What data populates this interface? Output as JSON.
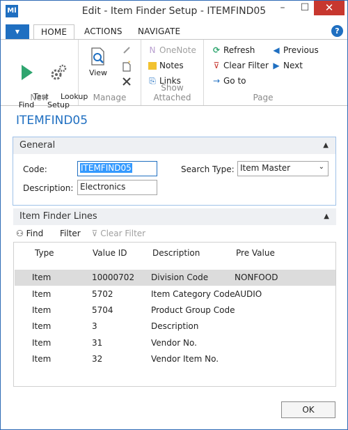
{
  "window": {
    "title": "Edit - Item Finder Setup - ITEMFIND05",
    "app_icon": "Ml",
    "minimize_glyph": "–",
    "maximize_glyph": "☐",
    "close_glyph": "✕"
  },
  "tabs": {
    "home": "HOME",
    "actions": "ACTIONS",
    "navigate": "NAVIGATE"
  },
  "ribbon": {
    "new": {
      "label": "New",
      "test_find": "Test\nFind",
      "lookup_setup": "Lookup\nSetup"
    },
    "manage": {
      "label": "Manage",
      "view": "View"
    },
    "show_attached": {
      "label": "Show Attached",
      "onenote": "OneNote",
      "notes": "Notes",
      "links": "Links"
    },
    "page": {
      "label": "Page",
      "refresh": "Refresh",
      "clear_filter": "Clear Filter",
      "go_to": "Go to",
      "previous": "Previous",
      "next": "Next"
    }
  },
  "record_title": "ITEMFIND05",
  "general": {
    "header": "General",
    "code_label": "Code:",
    "code_value": "ITEMFIND05",
    "description_label": "Description:",
    "description_value": "Electronics",
    "search_type_label": "Search Type:",
    "search_type_value": "Item Master"
  },
  "lines": {
    "header": "Item Finder Lines",
    "find": "Find",
    "filter": "Filter",
    "clear_filter": "Clear Filter",
    "columns": [
      "Type",
      "Value ID",
      "Description",
      "Pre Value"
    ],
    "rows": [
      {
        "type": "Item",
        "value_id": "10000702",
        "description": "Division Code",
        "pre_value": "NONFOOD"
      },
      {
        "type": "Item",
        "value_id": "5702",
        "description": "Item Category Code",
        "pre_value": "AUDIO"
      },
      {
        "type": "Item",
        "value_id": "5704",
        "description": "Product Group Code",
        "pre_value": ""
      },
      {
        "type": "Item",
        "value_id": "3",
        "description": "Description",
        "pre_value": ""
      },
      {
        "type": "Item",
        "value_id": "31",
        "description": "Vendor No.",
        "pre_value": ""
      },
      {
        "type": "Item",
        "value_id": "32",
        "description": "Vendor Item No.",
        "pre_value": ""
      }
    ]
  },
  "ok_label": "OK",
  "colors": {
    "accent": "#1f6fc1",
    "close": "#c7372f",
    "selected_row": "#dcdcdc"
  }
}
